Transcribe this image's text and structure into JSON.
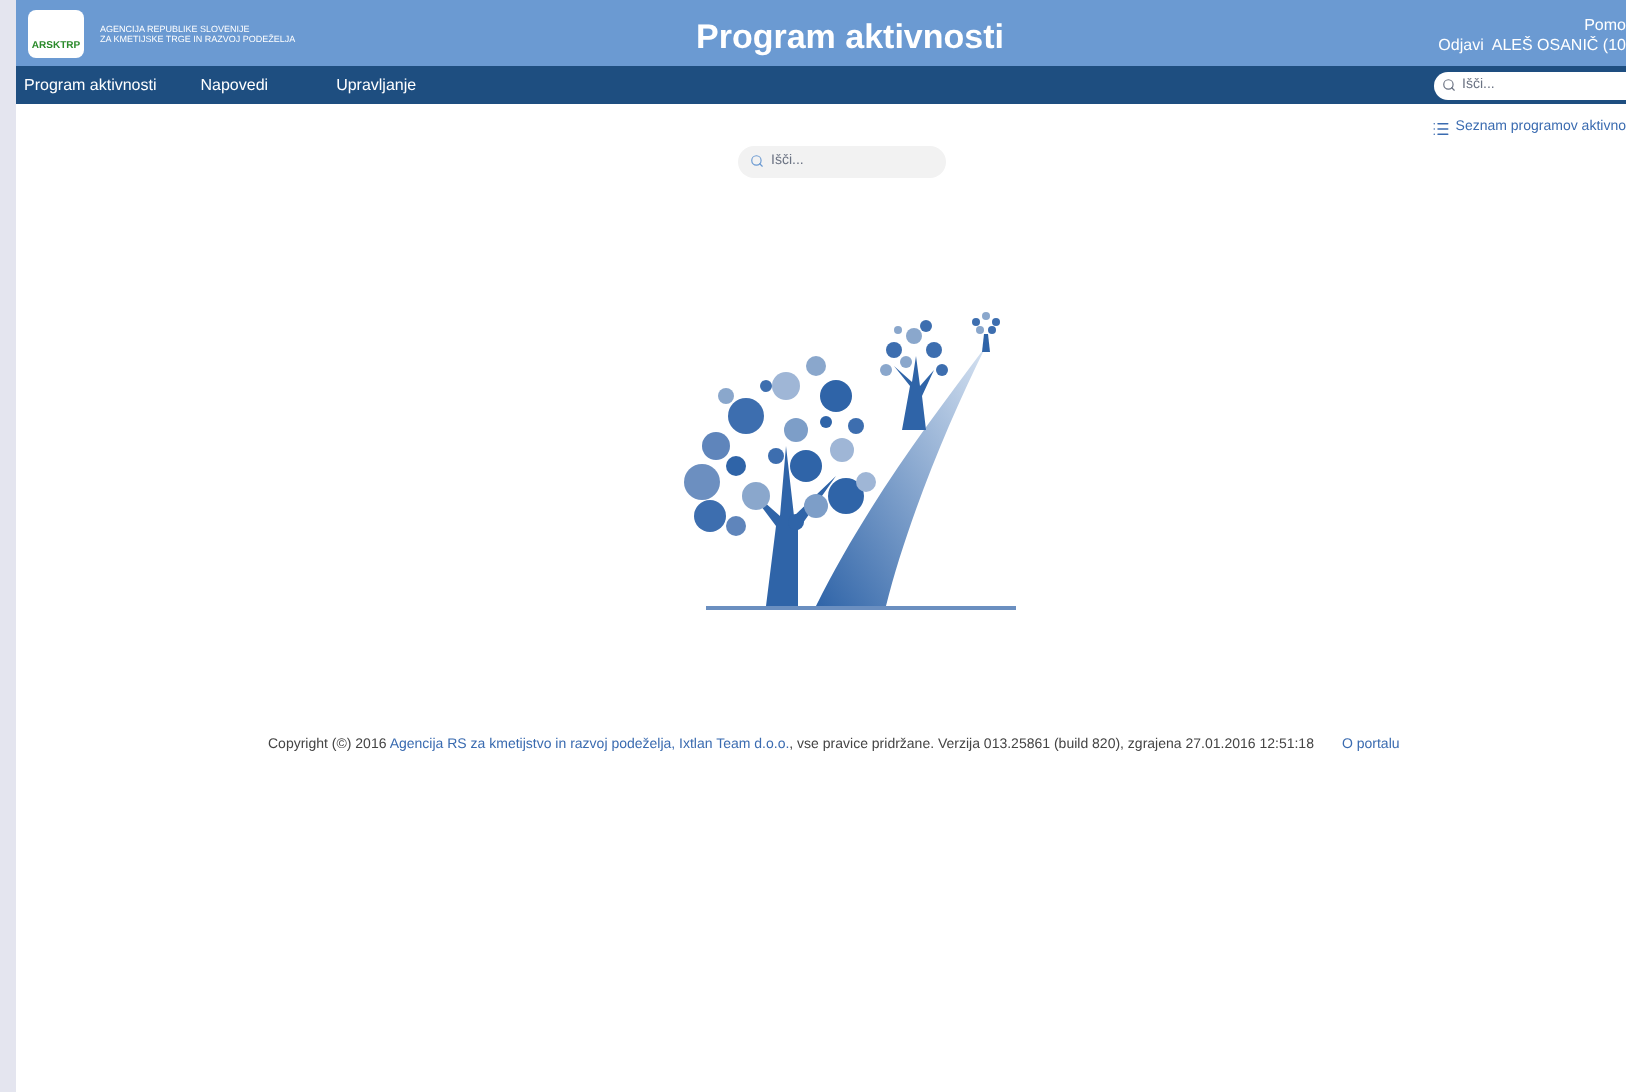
{
  "header": {
    "logo_text": "ARSKTRP",
    "agency_lines": [
      "AGENCIJA REPUBLIKE SLOVENIJE",
      "ZA KMETIJSKE TRGE IN RAZVOJ PODEŽELJA"
    ],
    "title": "Program aktivnosti",
    "help_link": "Pomo",
    "logout_link": "Odjavi",
    "user": "ALEŠ OSANIČ (10"
  },
  "nav": {
    "items": [
      {
        "label": "Program aktivnosti"
      },
      {
        "label": "Napovedi"
      },
      {
        "label": "Upravljanje"
      }
    ],
    "search": {
      "placeholder": "Išči..."
    }
  },
  "content": {
    "list_link": "Seznam programov aktivno",
    "search": {
      "placeholder": "Išči..."
    }
  },
  "footer": {
    "prefix": "Copyright (©) 2016 ",
    "link": "Agencija RS za kmetijstvo in razvoj podeželja, Ixtlan Team d.o.o.",
    "suffix": ", vse pravice pridržane. Verzija 013.25861 (build 820), zgrajena 27.01.2016 12:51:18",
    "about_link": "O portalu"
  }
}
